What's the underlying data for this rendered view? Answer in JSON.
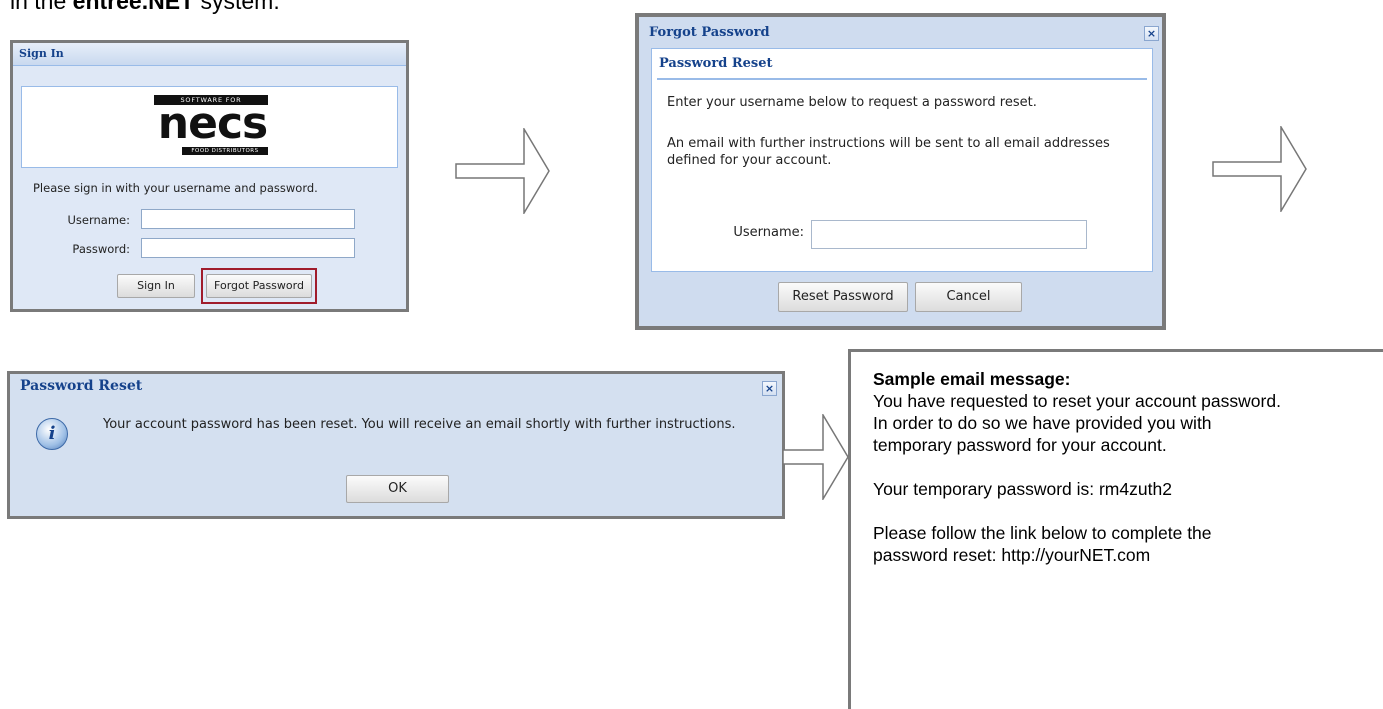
{
  "intro": {
    "prefix": "in the ",
    "product": "entree.NET",
    "suffix": " system."
  },
  "signin": {
    "title": "Sign In",
    "logo": {
      "top": "SOFTWARE FOR",
      "word": "necs",
      "bottom": "FOOD DISTRIBUTORS"
    },
    "prompt": "Please sign in with your username and password.",
    "username_label": "Username:",
    "password_label": "Password:",
    "username_value": "",
    "password_value": "",
    "signin_button": "Sign In",
    "forgot_button": "Forgot Password"
  },
  "forgot_dialog": {
    "title": "Forgot Password",
    "section": "Password Reset",
    "line1": "Enter your username below to request a password reset.",
    "line2": "An email with further instructions will be sent to all email addresses defined for your account.",
    "username_label": "Username:",
    "username_value": "",
    "reset_button": "Reset Password",
    "cancel_button": "Cancel",
    "close": "×"
  },
  "reset_message": {
    "title": "Password Reset",
    "icon": "info-icon",
    "message": "Your account password has been reset. You will receive an email shortly with further instructions.",
    "ok_button": "OK",
    "close": "×"
  },
  "email": {
    "heading": "Sample email message:",
    "para1": "You have requested to reset your account password. In order to do so we have provided you with temporary password for your account.",
    "para2": "Your temporary password is: rm4zuth2",
    "para3": "Please follow the link below to complete the password reset: http://yourNET.com"
  },
  "colors": {
    "title_blue": "#15428b",
    "dialog_bg": "#cfdcef",
    "frame_gray": "#7a7a7a",
    "highlight_red": "#a01c2c"
  }
}
